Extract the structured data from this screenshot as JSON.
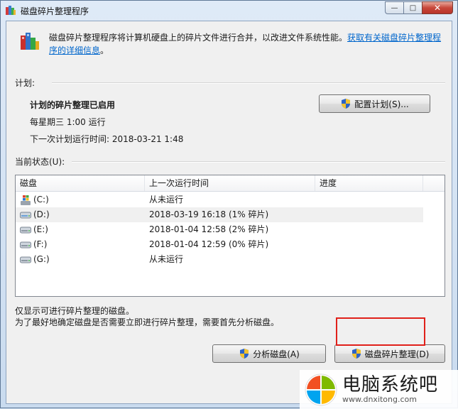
{
  "window": {
    "title": "磁盘碎片整理程序",
    "minimize_glyph": "—",
    "maximize_glyph": "□",
    "close_glyph": "✕"
  },
  "intro": {
    "text": "磁盘碎片整理程序将计算机硬盘上的碎片文件进行合并，以改进文件系统性能。",
    "link": "获取有关磁盘碎片整理程序的详细信息",
    "trailing": "。"
  },
  "schedule": {
    "group_label": "计划:",
    "status": "计划的碎片整理已启用",
    "frequency": "每星期三  1:00 运行",
    "next_run": "下一次计划运行时间: 2018-03-21 1:48",
    "configure_button": "配置计划(S)..."
  },
  "current_status": {
    "group_label": "当前状态(U):",
    "columns": [
      "磁盘",
      "上一次运行时间",
      "进度"
    ],
    "rows": [
      {
        "disk": "(C:)",
        "last_run": "从未运行",
        "progress": "",
        "icon": "windows-drive-icon"
      },
      {
        "disk": "(D:)",
        "last_run": "2018-03-19 16:18 (1% 碎片)",
        "progress": "",
        "icon": "hard-drive-icon"
      },
      {
        "disk": "(E:)",
        "last_run": "2018-01-04 12:58 (2% 碎片)",
        "progress": "",
        "icon": "hard-drive-icon"
      },
      {
        "disk": "(F:)",
        "last_run": "2018-01-04 12:59 (0% 碎片)",
        "progress": "",
        "icon": "hard-drive-icon"
      },
      {
        "disk": "(G:)",
        "last_run": "从未运行",
        "progress": "",
        "icon": "hard-drive-icon"
      }
    ]
  },
  "notes": {
    "line1": "仅显示可进行碎片整理的磁盘。",
    "line2": "为了最好地确定磁盘是否需要立即进行碎片整理，需要首先分析磁盘。"
  },
  "actions": {
    "analyze_button": "分析磁盘(A)",
    "defrag_button": "磁盘碎片整理(D)"
  },
  "watermark": {
    "title": "电脑系统吧",
    "url": "www.dnxitong.com"
  },
  "colors": {
    "accent_highlight": "#e0201a",
    "link": "#0066cc"
  }
}
